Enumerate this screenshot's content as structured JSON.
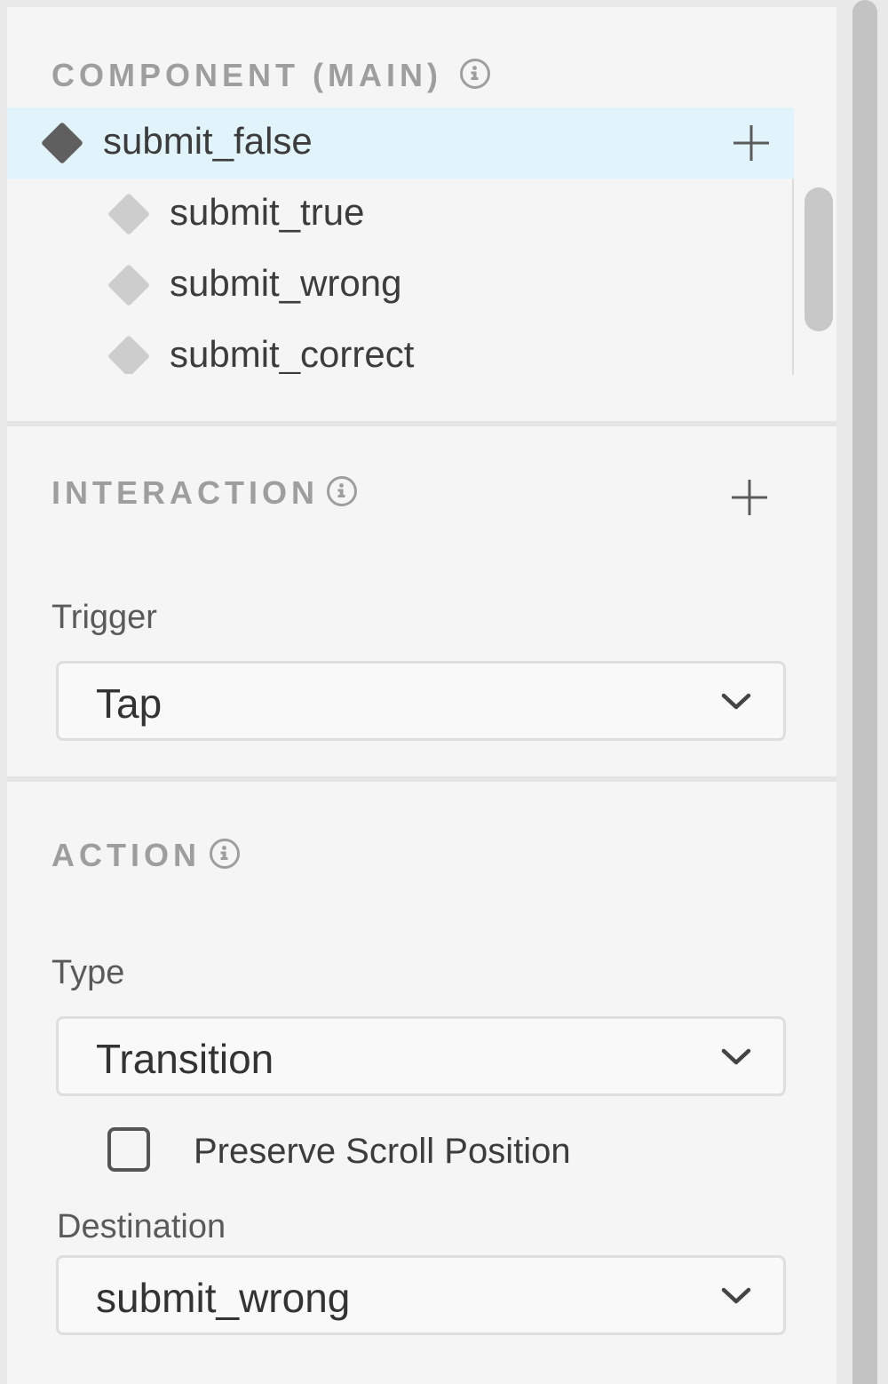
{
  "component": {
    "title": "COMPONENT (MAIN)",
    "items": [
      {
        "label": "submit_false",
        "icon": "diamond-filled-icon",
        "selected": true
      },
      {
        "label": "submit_true",
        "icon": "diamond-outline-icon",
        "selected": false
      },
      {
        "label": "submit_wrong",
        "icon": "diamond-outline-icon",
        "selected": false
      },
      {
        "label": "submit_correct",
        "icon": "diamond-outline-icon",
        "selected": false
      }
    ]
  },
  "interaction": {
    "title": "INTERACTION",
    "trigger_label": "Trigger",
    "trigger_value": "Tap"
  },
  "action": {
    "title": "ACTION",
    "type_label": "Type",
    "type_value": "Transition",
    "preserve_scroll_label": "Preserve Scroll Position",
    "preserve_scroll_checked": false,
    "destination_label": "Destination",
    "destination_value": "submit_wrong"
  },
  "colors": {
    "selected_row": "#e1f3fb",
    "section_title": "#9e9e9e",
    "panel_bg": "#f5f5f5"
  }
}
